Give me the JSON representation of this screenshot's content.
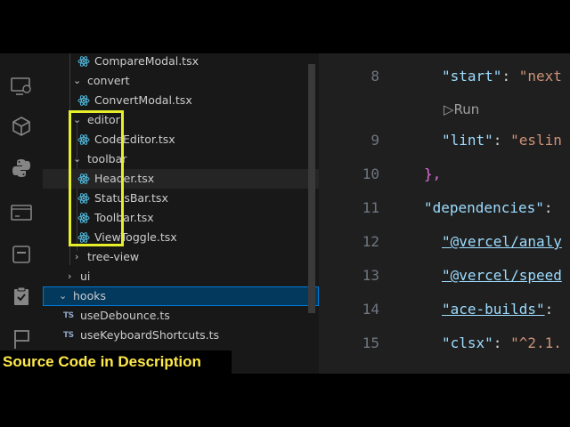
{
  "explorer": {
    "rows": [
      {
        "label": "CompareModal.tsx",
        "type": "react-file"
      },
      {
        "label": "convert",
        "type": "folder-open"
      },
      {
        "label": "ConvertModal.tsx",
        "type": "react-file"
      },
      {
        "label": "editor",
        "type": "folder-open"
      },
      {
        "label": "CodeEditor.tsx",
        "type": "react-file"
      },
      {
        "label": "toolbar",
        "type": "folder-open"
      },
      {
        "label": "Header.tsx",
        "type": "react-file"
      },
      {
        "label": "StatusBar.tsx",
        "type": "react-file"
      },
      {
        "label": "Toolbar.tsx",
        "type": "react-file"
      },
      {
        "label": "ViewToggle.tsx",
        "type": "react-file"
      },
      {
        "label": "tree-view",
        "type": "folder-closed"
      },
      {
        "label": "ui",
        "type": "folder-closed"
      },
      {
        "label": "hooks",
        "type": "folder-open"
      },
      {
        "label": "useDebounce.ts",
        "type": "ts-file",
        "badge": "TS"
      },
      {
        "label": "useKeyboardShortcuts.ts",
        "type": "ts-file",
        "badge": "TS"
      }
    ]
  },
  "editor": {
    "lines": [
      {
        "num": "8",
        "key": "\"start\"",
        "val": "\"next"
      },
      {
        "num": "9",
        "key": "\"lint\"",
        "val": "\"eslin"
      },
      {
        "num": "10",
        "text": "},"
      },
      {
        "num": "11",
        "key": "\"dependencies\"",
        "punct": ":"
      },
      {
        "num": "12",
        "key": "\"@vercel/analy"
      },
      {
        "num": "13",
        "key": "\"@vercel/speed"
      },
      {
        "num": "14",
        "key": "\"ace-builds\"",
        "punct": ":"
      },
      {
        "num": "15",
        "key": "\"clsx\"",
        "val": "\"^2.1."
      }
    ],
    "codelens": "Run"
  },
  "banner": "Source Code in  Description",
  "colors": {
    "highlight": "#e6ef29",
    "selection": "#04395e",
    "accent": "#0078d4"
  }
}
